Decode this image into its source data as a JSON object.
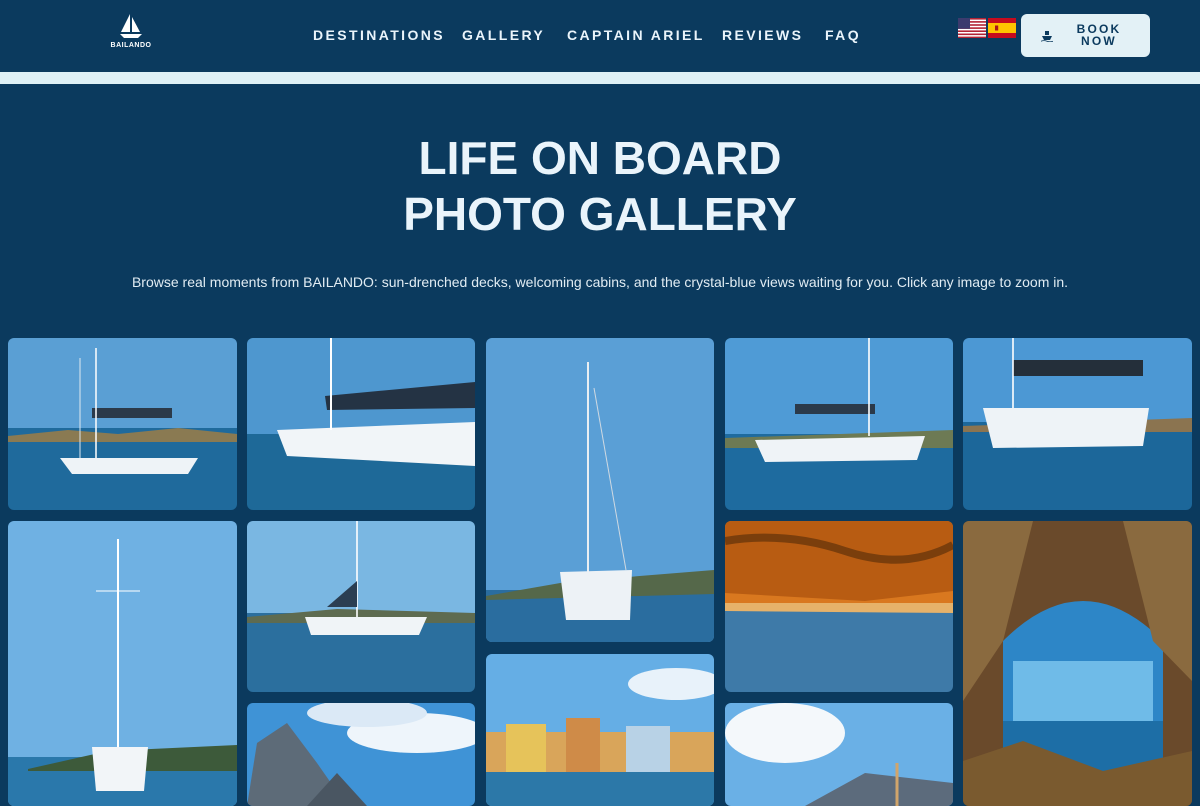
{
  "brand": {
    "name": "BAILANDO"
  },
  "nav": {
    "items": [
      {
        "label": "DESTINATIONS"
      },
      {
        "label": "GALLERY"
      },
      {
        "label": "CAPTAIN ARIEL"
      },
      {
        "label": "REVIEWS"
      },
      {
        "label": "FAQ"
      }
    ]
  },
  "languages": [
    {
      "code": "en",
      "icon": "us-flag-icon"
    },
    {
      "code": "es",
      "icon": "spain-flag-icon"
    }
  ],
  "cta": {
    "line1": "BOOK",
    "line2": "NOW",
    "icon": "boat-icon"
  },
  "hero": {
    "title_line1": "LIFE ON BOARD",
    "title_line2": "PHOTO GALLERY",
    "subtitle": "Browse real moments from BAILANDO: sun-drenched decks, welcoming cabins, and the crystal-blue views waiting for you. Click any image to zoom in."
  },
  "gallery": {
    "photos": [
      {
        "subject": "sailboat anchored in turquoise bay"
      },
      {
        "subject": "sailboat hull close-up on blue water"
      },
      {
        "subject": "sailboat with tall mast under blue sky"
      },
      {
        "subject": "sailboat moving on open sea"
      },
      {
        "subject": "sailboat stern with bimini top"
      },
      {
        "subject": "tall mast sailboat near coast"
      },
      {
        "subject": "sailboat on calm water"
      },
      {
        "subject": "golden cliffs at sunset beach"
      },
      {
        "subject": "sea cave arch with ocean view"
      },
      {
        "subject": "rocky island with clouds"
      },
      {
        "subject": "colorful harbor town"
      },
      {
        "subject": "sunlit coastal hills"
      }
    ]
  },
  "colors": {
    "background": "#0b3a5e",
    "accent": "#e3f1f6",
    "text": "#eaf4fb"
  }
}
